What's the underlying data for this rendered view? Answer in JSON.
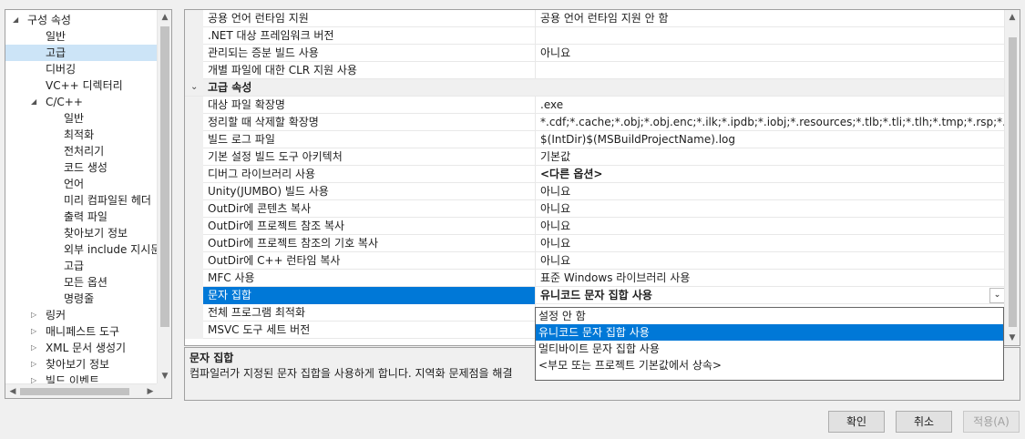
{
  "tree": {
    "items": [
      {
        "label": "구성 속성",
        "expander": "◢",
        "level": 0,
        "selected": false
      },
      {
        "label": "일반",
        "expander": "",
        "level": 1,
        "selected": false
      },
      {
        "label": "고급",
        "expander": "",
        "level": 1,
        "selected": true
      },
      {
        "label": "디버깅",
        "expander": "",
        "level": 1,
        "selected": false
      },
      {
        "label": "VC++ 디렉터리",
        "expander": "",
        "level": 1,
        "selected": false
      },
      {
        "label": "C/C++",
        "expander": "◢",
        "level": 1,
        "selected": false
      },
      {
        "label": "일반",
        "expander": "",
        "level": 2,
        "selected": false
      },
      {
        "label": "최적화",
        "expander": "",
        "level": 2,
        "selected": false
      },
      {
        "label": "전처리기",
        "expander": "",
        "level": 2,
        "selected": false
      },
      {
        "label": "코드 생성",
        "expander": "",
        "level": 2,
        "selected": false
      },
      {
        "label": "언어",
        "expander": "",
        "level": 2,
        "selected": false
      },
      {
        "label": "미리 컴파일된 헤더",
        "expander": "",
        "level": 2,
        "selected": false
      },
      {
        "label": "출력 파일",
        "expander": "",
        "level": 2,
        "selected": false
      },
      {
        "label": "찾아보기 정보",
        "expander": "",
        "level": 2,
        "selected": false
      },
      {
        "label": "외부 include 지시문",
        "expander": "",
        "level": 2,
        "selected": false
      },
      {
        "label": "고급",
        "expander": "",
        "level": 2,
        "selected": false
      },
      {
        "label": "모든 옵션",
        "expander": "",
        "level": 2,
        "selected": false
      },
      {
        "label": "명령줄",
        "expander": "",
        "level": 2,
        "selected": false
      },
      {
        "label": "링커",
        "expander": "▷",
        "level": 1,
        "selected": false
      },
      {
        "label": "매니페스트 도구",
        "expander": "▷",
        "level": 1,
        "selected": false
      },
      {
        "label": "XML 문서 생성기",
        "expander": "▷",
        "level": 1,
        "selected": false
      },
      {
        "label": "찾아보기 정보",
        "expander": "▷",
        "level": 1,
        "selected": false
      },
      {
        "label": "빌드 이벤트",
        "expander": "▷",
        "level": 1,
        "selected": false
      }
    ]
  },
  "grid": {
    "rows": [
      {
        "type": "prop",
        "name": "공용 언어 런타임 지원",
        "value": "공용 언어 런타임 지원 안 함",
        "bold": false
      },
      {
        "type": "prop",
        "name": ".NET 대상 프레임워크 버전",
        "value": "",
        "bold": false
      },
      {
        "type": "prop",
        "name": "관리되는 증분 빌드 사용",
        "value": "아니요",
        "bold": false
      },
      {
        "type": "prop",
        "name": "개별 파일에 대한 CLR 지원 사용",
        "value": "",
        "bold": false
      },
      {
        "type": "cat",
        "name": "고급 속성",
        "toggle": "⌄"
      },
      {
        "type": "prop",
        "name": "대상 파일 확장명",
        "value": ".exe",
        "bold": false
      },
      {
        "type": "prop",
        "name": "정리할 때 삭제할 확장명",
        "value": "*.cdf;*.cache;*.obj;*.obj.enc;*.ilk;*.ipdb;*.iobj;*.resources;*.tlb;*.tli;*.tlh;*.tmp;*.rsp;*.pgc;*.pgd;*.m",
        "bold": false
      },
      {
        "type": "prop",
        "name": "빌드 로그 파일",
        "value": "$(IntDir)$(MSBuildProjectName).log",
        "bold": false
      },
      {
        "type": "prop",
        "name": "기본 설정 빌드 도구 아키텍처",
        "value": "기본값",
        "bold": false
      },
      {
        "type": "prop",
        "name": "디버그 라이브러리 사용",
        "value": "<다른 옵션>",
        "bold": true
      },
      {
        "type": "prop",
        "name": "Unity(JUMBO) 빌드 사용",
        "value": "아니요",
        "bold": false
      },
      {
        "type": "prop",
        "name": "OutDir에 콘텐츠 복사",
        "value": "아니요",
        "bold": false
      },
      {
        "type": "prop",
        "name": "OutDir에 프로젝트 참조 복사",
        "value": "아니요",
        "bold": false
      },
      {
        "type": "prop",
        "name": "OutDir에 프로젝트 참조의 기호 복사",
        "value": "아니요",
        "bold": false
      },
      {
        "type": "prop",
        "name": "OutDir에 C++ 런타임 복사",
        "value": "아니요",
        "bold": false
      },
      {
        "type": "prop",
        "name": "MFC 사용",
        "value": "표준 Windows 라이브러리 사용",
        "bold": false
      },
      {
        "type": "sel",
        "name": "문자 집합",
        "value": "유니코드 문자 집합 사용",
        "bold": true
      },
      {
        "type": "prop",
        "name": "전체 프로그램 최적화",
        "value": "",
        "bold": false
      },
      {
        "type": "prop",
        "name": "MSVC 도구 세트 버전",
        "value": "",
        "bold": false
      }
    ]
  },
  "dropdown": {
    "options": [
      {
        "label": "설정 안 함",
        "highlighted": false
      },
      {
        "label": "유니코드 문자 집합 사용",
        "highlighted": true
      },
      {
        "label": "멀티바이트 문자 집합 사용",
        "highlighted": false
      },
      {
        "label": "<부모 또는 프로젝트 기본값에서 상속>",
        "highlighted": false
      }
    ]
  },
  "description": {
    "title": "문자 집합",
    "text": "컴파일러가 지정된 문자 집합을 사용하게 합니다. 지역화 문제점을 해결"
  },
  "buttons": {
    "ok": "확인",
    "cancel": "취소",
    "apply": "적용(A)"
  },
  "icons": {
    "scroll_up": "▲",
    "scroll_down": "▼",
    "scroll_left": "◀",
    "scroll_right": "▶",
    "combo_arrow": "⌄"
  },
  "colors": {
    "selection": "#0078d7",
    "tree_selection": "#cce4f7"
  }
}
